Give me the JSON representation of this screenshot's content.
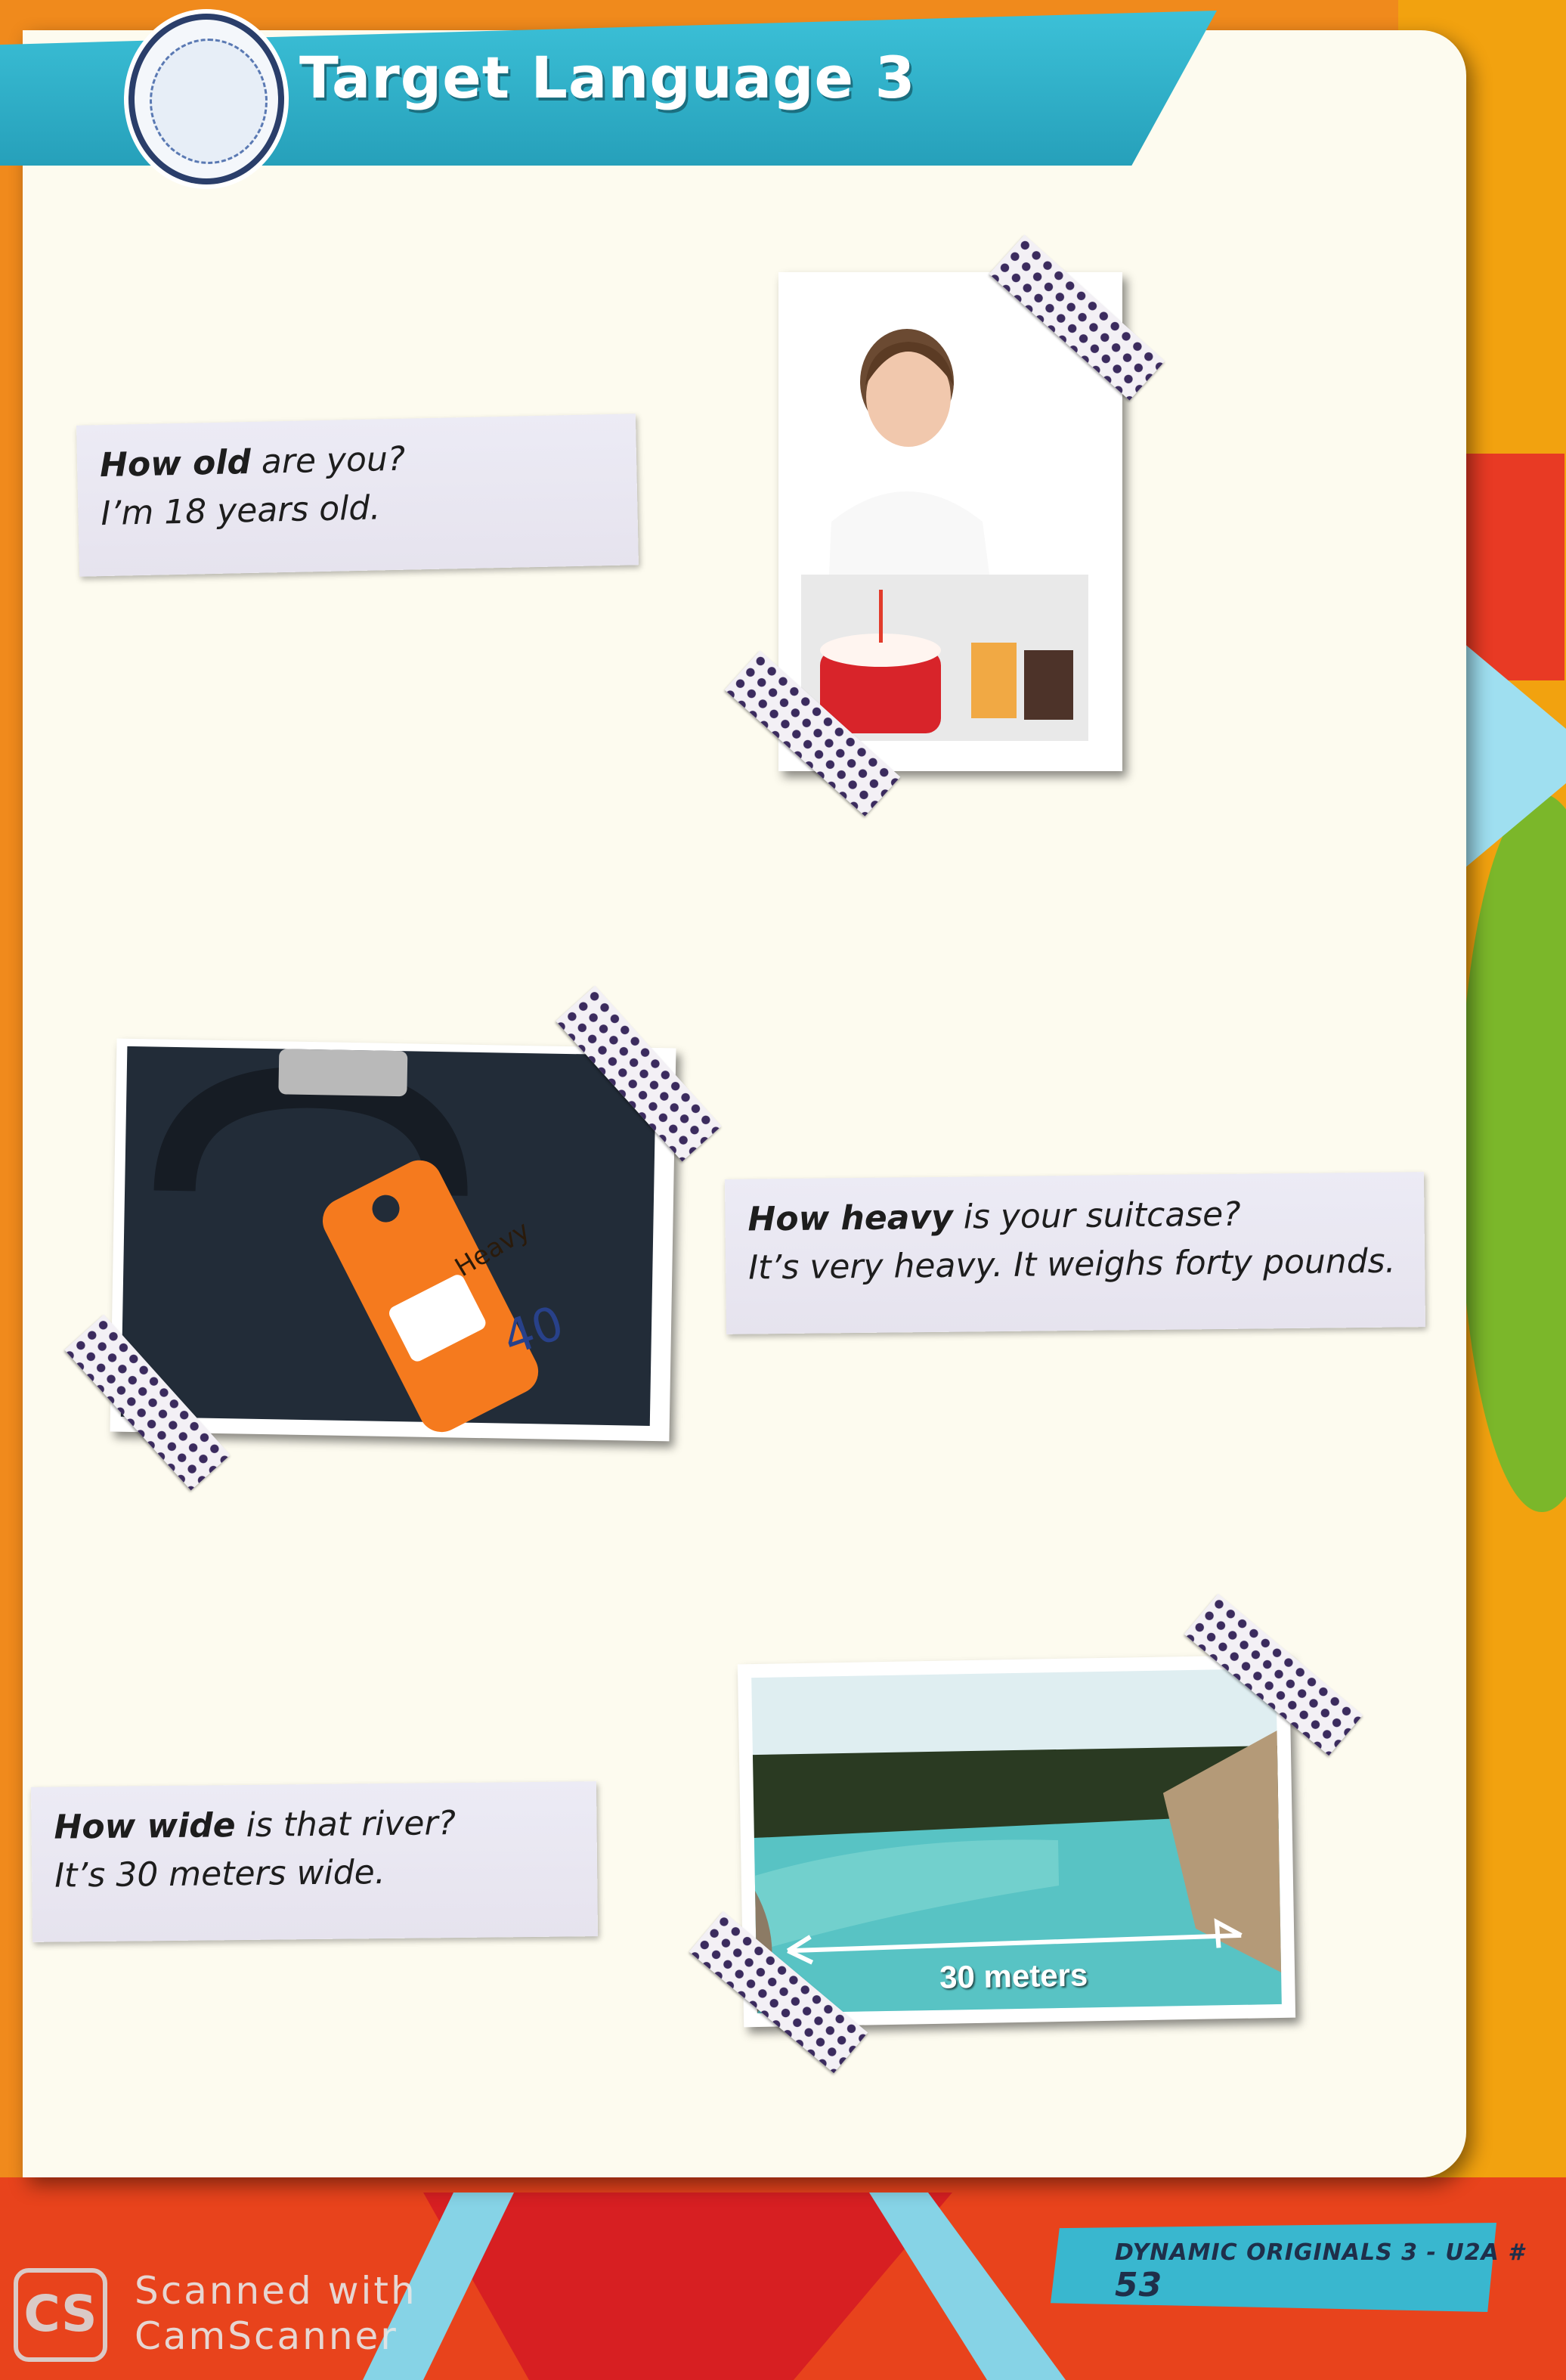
{
  "header": {
    "title": "Target Language 3"
  },
  "sections": [
    {
      "question_bold": "How old",
      "question_rest": " are you?",
      "answer": "I’m 18 years old."
    },
    {
      "question_bold": "How heavy",
      "question_rest": " is your suitcase?",
      "answer": "It’s very heavy. It weighs forty pounds."
    },
    {
      "question_bold": "How wide",
      "question_rest": " is that river?",
      "answer": "It’s 30 meters wide."
    }
  ],
  "photos": {
    "tag_label": "Heavy",
    "tag_number": "40",
    "river_label": "30 meters"
  },
  "footer": {
    "book": "DYNAMIC ORIGINALS 3 - U2A #",
    "page": "53"
  },
  "watermark": {
    "logo": "CS",
    "line1": "Scanned with",
    "line2": "CamScanner"
  },
  "colors": {
    "ribbon": "#2fb2c9",
    "tape_dots": "#3b2b5e",
    "tag": "#f57a1e",
    "page": "#fdfbef"
  }
}
